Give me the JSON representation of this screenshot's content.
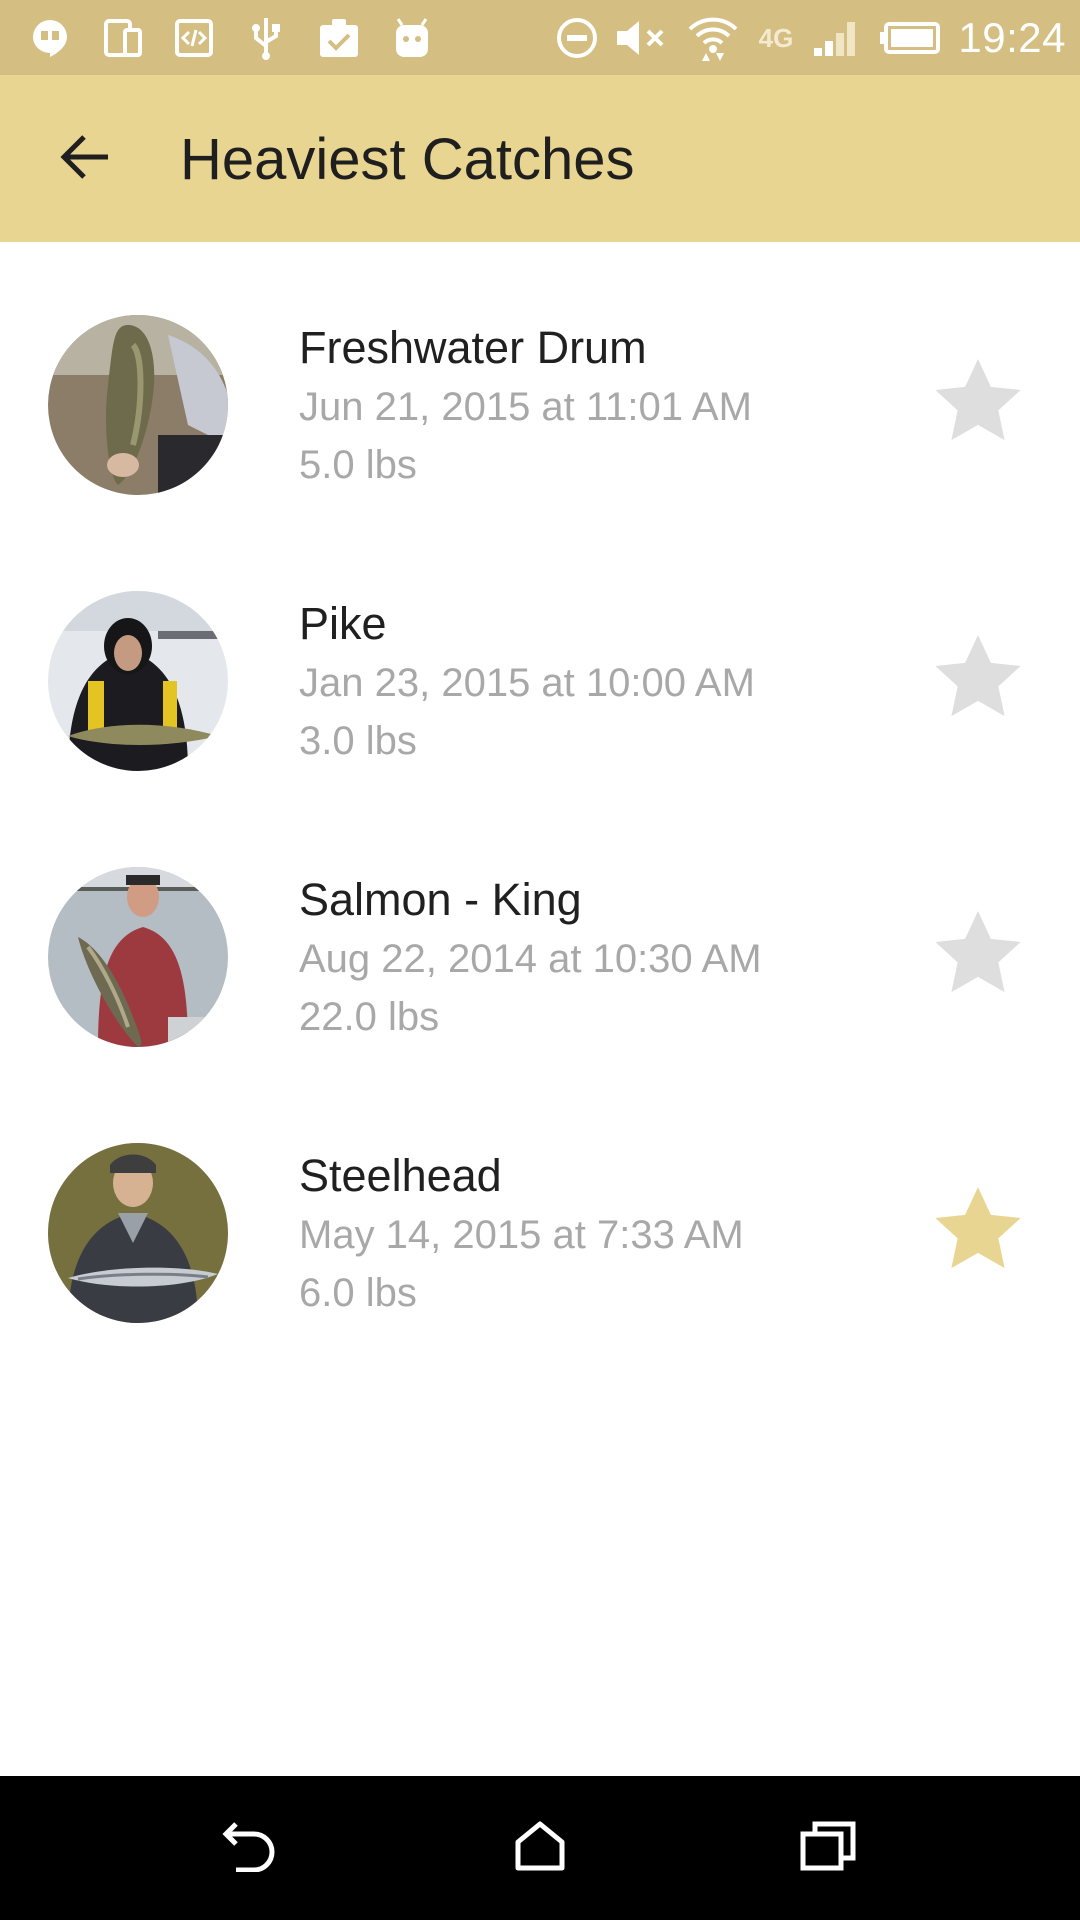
{
  "status_bar": {
    "time": "19:24",
    "network_label": "4G",
    "icons": [
      "hangouts-icon",
      "devices-icon",
      "code-icon",
      "usb-icon",
      "clipboard-check-icon",
      "android-icon",
      "do-not-disturb-icon",
      "volume-muted-icon",
      "wifi-icon",
      "signal-icon",
      "battery-icon"
    ]
  },
  "app_bar": {
    "title": "Heaviest Catches",
    "back_icon": "arrow-back-icon"
  },
  "catches": [
    {
      "name": "Freshwater Drum",
      "date": "Jun 21, 2015 at 11:01 AM",
      "weight": "5.0 lbs",
      "favorite": false
    },
    {
      "name": "Pike",
      "date": "Jan 23, 2015 at 10:00 AM",
      "weight": "3.0 lbs",
      "favorite": false
    },
    {
      "name": "Salmon - King",
      "date": "Aug 22, 2014 at 10:30 AM",
      "weight": "22.0 lbs",
      "favorite": false
    },
    {
      "name": "Steelhead",
      "date": "May 14, 2015 at 7:33 AM",
      "weight": "6.0 lbs",
      "favorite": true
    }
  ],
  "colors": {
    "status_bar": "#d4be82",
    "app_bar": "#e9d592",
    "star_active": "#e9d592",
    "star_inactive": "#dedede",
    "secondary_text": "#a8a8a8"
  },
  "nav_bar": {
    "icons": [
      "back-nav-icon",
      "home-icon",
      "recents-icon"
    ]
  }
}
